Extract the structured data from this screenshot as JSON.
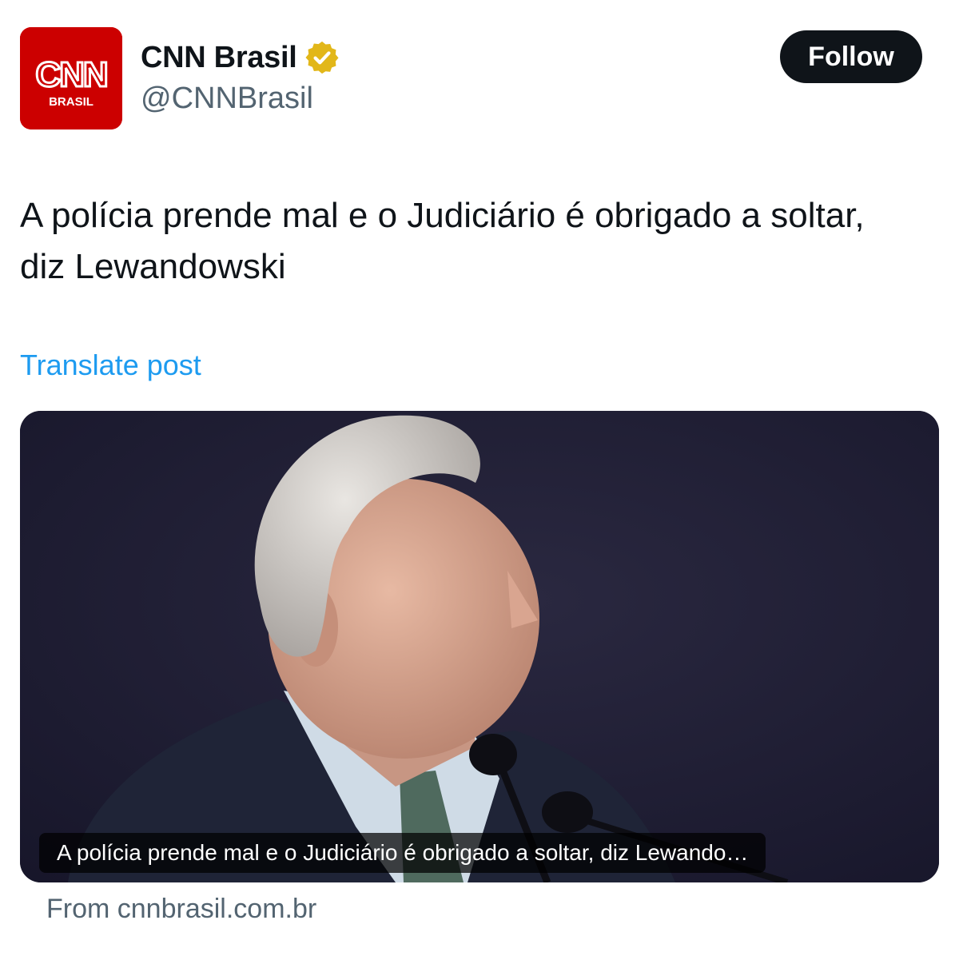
{
  "account": {
    "display_name": "CNN Brasil",
    "handle": "@CNNBrasil",
    "verified": true,
    "verified_badge_color": "#e2b719",
    "avatar": {
      "logo_text": "CNN",
      "sub_text": "BRASIL",
      "background": "#cc0000"
    }
  },
  "follow_button": {
    "label": "Follow"
  },
  "post": {
    "text": "A polícia prende mal e o Judiciário é obrigado a soltar, diz Lewandowski",
    "translate_label": "Translate post"
  },
  "link_card": {
    "caption": "A polícia prende mal e o Judiciário é obrigado a soltar, diz Lewando…",
    "source": "From cnnbrasil.com.br"
  },
  "colors": {
    "text": "#0f1419",
    "secondary": "#536471",
    "link": "#1d9bf0",
    "button": "#0f1419"
  }
}
